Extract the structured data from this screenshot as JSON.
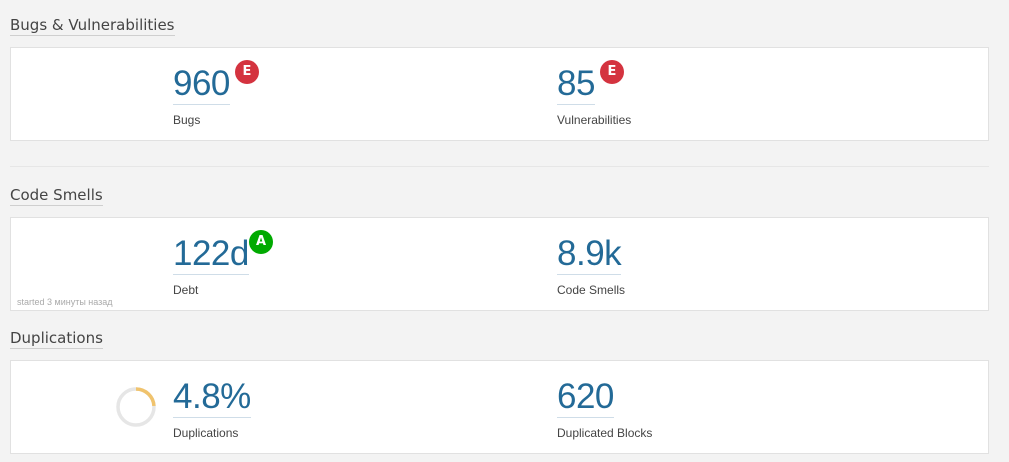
{
  "sections": {
    "bugs": {
      "title": "Bugs & Vulnerabilities",
      "bugs": {
        "value": "960",
        "label": "Bugs",
        "rating": "E"
      },
      "vulnerabilities": {
        "value": "85",
        "label": "Vulnerabilities",
        "rating": "E"
      }
    },
    "smells": {
      "title": "Code Smells",
      "debt": {
        "value": "122d",
        "label": "Debt",
        "rating": "A"
      },
      "code_smells": {
        "value": "8.9k",
        "label": "Code Smells"
      },
      "started": "started 3 минуты назад"
    },
    "duplications": {
      "title": "Duplications",
      "duplications": {
        "value": "4.8%",
        "label": "Duplications",
        "percent": 4.8
      },
      "blocks": {
        "value": "620",
        "label": "Duplicated Blocks"
      }
    }
  },
  "colors": {
    "value": "#236a97",
    "rating_e": "#d4333f",
    "rating_a": "#00aa00",
    "donut_fill": "#f0c36d",
    "donut_track": "#e6e6e6"
  },
  "icons": {
    "duplication_indicator": "donut-chart-icon"
  }
}
